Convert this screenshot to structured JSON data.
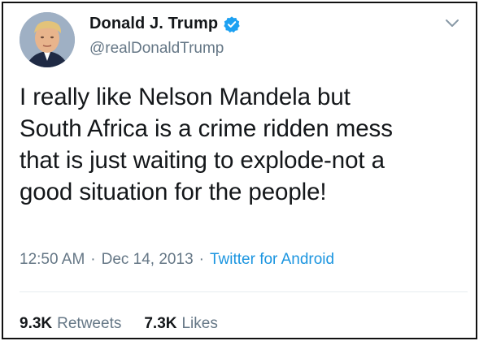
{
  "author": {
    "display_name": "Donald J. Trump",
    "handle": "@realDonaldTrump",
    "verified": true
  },
  "tweet": {
    "text": "I really like Nelson Mandela but\nSouth Africa is a crime ridden mess\nthat is just waiting to explode-not a\ngood situation for the people!"
  },
  "meta": {
    "time": "12:50 AM",
    "separator": "·",
    "date": "Dec 14, 2013",
    "source": "Twitter for Android"
  },
  "stats": {
    "retweets_count": "9.3K",
    "retweets_label": "Retweets",
    "likes_count": "7.3K",
    "likes_label": "Likes"
  },
  "colors": {
    "verified_badge": "#1da1f2",
    "link": "#1b95e0",
    "muted_text": "#657786"
  },
  "icons": {
    "verified": "verified-badge-icon",
    "menu": "chevron-down-icon"
  }
}
